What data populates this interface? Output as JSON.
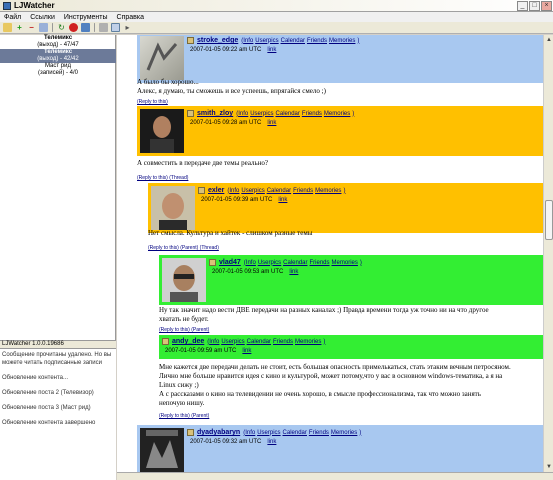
{
  "window": {
    "title": "LJWatcher",
    "minimize": "_",
    "maximize": "□",
    "close": "×"
  },
  "menu": [
    "Файл",
    "Ссылки",
    "Инструменты",
    "Справка"
  ],
  "journals": [
    {
      "name": "Телемикс",
      "sub": "(выход) - 47/47",
      "selected": false
    },
    {
      "name": "Телемикс",
      "sub": "(выход) - 42/42",
      "selected": true
    },
    {
      "name": "Маст рид",
      "sub": "(записей) - 4/0",
      "selected": false
    }
  ],
  "version": "LJWatcher 1.0.0.19686",
  "log": [
    "Сообщение прочитаны удалено. Но вы можете читать подписанные записи",
    "Обновление контента...",
    "Обновление поста 2 (Телевизор)",
    "Обновление поста 3 (Маст рид)",
    "Обновление контента завершено"
  ],
  "link_labels": [
    "Info",
    "Userpics",
    "Calendar",
    "Friends",
    "Memories"
  ],
  "link_word": "link",
  "entries": [
    {
      "user": "stroke_edge",
      "date": "2007-01-05 09:22 am UTC",
      "color": "#a8c8f0",
      "text": [
        "А было бы хорошо...",
        "Алекс, я думаю, ты сможешь и все успеешь, впрягайся смело ;)"
      ],
      "reply": "(Reply to this)"
    },
    {
      "user": "smith_zloy",
      "date": "2007-01-05 09:28 am UTC",
      "color": "#ffc000",
      "text": [
        "А совместить в передаче две темы реально?"
      ],
      "reply": "(Reply to this) (Thread)"
    },
    {
      "user": "exler",
      "date": "2007-01-05 09:39 am UTC",
      "color": "#ffc000",
      "text": [
        "Нет смысла. Культура и хайтек - слишком разные темы"
      ],
      "reply": "(Reply to this) (Parent) (Thread)"
    },
    {
      "user": "vlad47",
      "date": "2007-01-05 09:53 am UTC",
      "color": "#33ee33",
      "text": [
        "Ну так значит надо вести ДВЕ передачи на разных каналах ;) Правда времени тогда уж точно ни на что другое",
        "хватать не будет."
      ],
      "reply": "(Reply to this) (Parent)"
    },
    {
      "user": "andy_dee",
      "date": "2007-01-05 09:59 am UTC",
      "color": "#33ee33",
      "text": [
        "Мне кажется две передачи делать не стоит, есть большая опасность примелькаться, стать этаким вечным петросяном.",
        "Лично мне больше нравится идея с кино и культурой, может потому,что у вас в основном windows-тематика, а я на",
        "Linux сижу ;)",
        "А с рассказами о кино на телевидении не очень хорошо, в смысле профессионализма, так что можно занять",
        "непочую нишу."
      ],
      "reply": "(Reply to this) (Parent)"
    },
    {
      "user": "dyadyabaryn",
      "date": "2007-01-05 09:32 am UTC",
      "color": "#a8c8f0",
      "text": [],
      "reply": ""
    }
  ]
}
